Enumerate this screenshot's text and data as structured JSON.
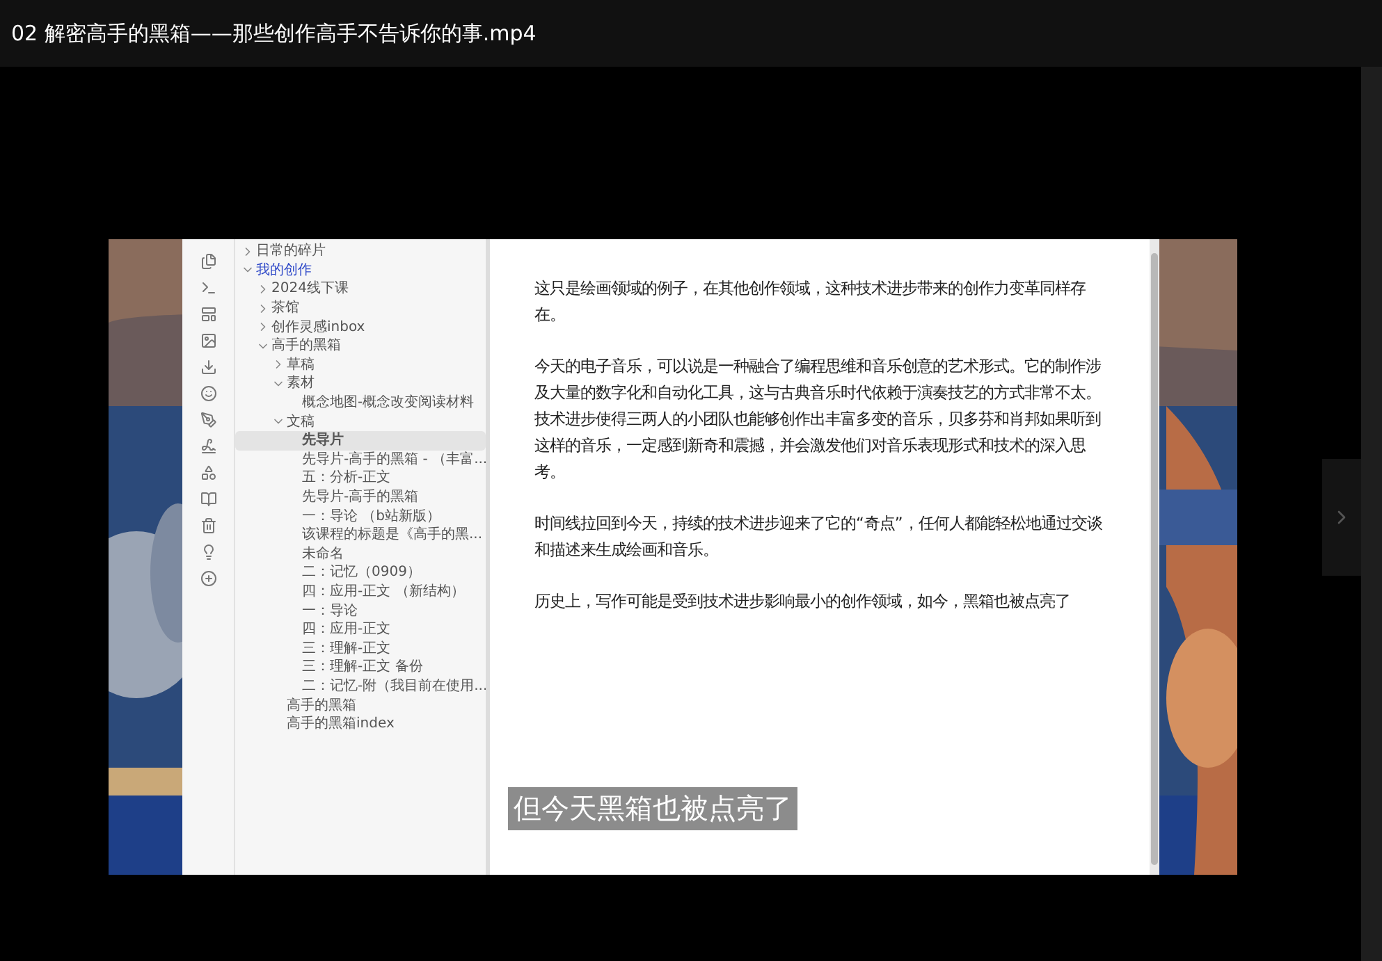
{
  "window": {
    "title": "02 解密高手的黑箱——那些创作高手不告诉你的事.mp4"
  },
  "video": {
    "kind": "picture",
    "tree": [
      {
        "label": "日常的碎片",
        "kind": "folder",
        "expanded": false,
        "current": false,
        "selected": false
      },
      {
        "label": "我的创作",
        "kind": "folder",
        "expanded": true,
        "current": true,
        "selected": false,
        "children": [
          {
            "label": "2024线下课",
            "kind": "folder",
            "expanded": false,
            "current": false,
            "selected": false
          },
          {
            "label": "茶馆",
            "kind": "folder",
            "expanded": false,
            "current": false,
            "selected": false
          },
          {
            "label": "创作灵感inbox",
            "kind": "folder",
            "expanded": false,
            "current": false,
            "selected": false
          },
          {
            "label": "高手的黑箱",
            "kind": "folder",
            "expanded": true,
            "current": false,
            "selected": false,
            "children": [
              {
                "label": "草稿",
                "kind": "folder",
                "expanded": false,
                "current": false,
                "selected": false
              },
              {
                "label": "素材",
                "kind": "folder",
                "expanded": true,
                "current": false,
                "selected": false,
                "children": [
                  {
                    "label": "概念地图-概念改变阅读材料",
                    "kind": "file",
                    "current": false,
                    "selected": false
                  }
                ]
              },
              {
                "label": "文稿",
                "kind": "folder",
                "expanded": true,
                "current": false,
                "selected": false,
                "children": [
                  {
                    "label": "先导片",
                    "kind": "file",
                    "current": false,
                    "selected": true
                  },
                  {
                    "label": "先导片-高手的黑箱 - （丰富...",
                    "kind": "file",
                    "current": false,
                    "selected": false
                  },
                  {
                    "label": "五：分析-正文",
                    "kind": "file",
                    "current": false,
                    "selected": false
                  },
                  {
                    "label": "先导片-高手的黑箱",
                    "kind": "file",
                    "current": false,
                    "selected": false
                  },
                  {
                    "label": "一：导论 （b站新版）",
                    "kind": "file",
                    "current": false,
                    "selected": false
                  },
                  {
                    "label": "该课程的标题是《高手的黑...",
                    "kind": "file",
                    "current": false,
                    "selected": false
                  },
                  {
                    "label": "未命名",
                    "kind": "file",
                    "current": false,
                    "selected": false
                  },
                  {
                    "label": "二：记忆（0909）",
                    "kind": "file",
                    "current": false,
                    "selected": false
                  },
                  {
                    "label": "四：应用-正文 （新结构）",
                    "kind": "file",
                    "current": false,
                    "selected": false
                  },
                  {
                    "label": "一：导论",
                    "kind": "file",
                    "current": false,
                    "selected": false
                  },
                  {
                    "label": "四：应用-正文",
                    "kind": "file",
                    "current": false,
                    "selected": false
                  },
                  {
                    "label": "三：理解-正文",
                    "kind": "file",
                    "current": false,
                    "selected": false
                  },
                  {
                    "label": "三：理解-正文 备份",
                    "kind": "file",
                    "current": false,
                    "selected": false
                  },
                  {
                    "label": "二：记忆-附（我目前在使用...",
                    "kind": "file",
                    "current": false,
                    "selected": false
                  }
                ]
              },
              {
                "label": "高手的黑箱",
                "kind": "file",
                "current": false,
                "selected": false
              },
              {
                "label": "高手的黑箱index",
                "kind": "file",
                "current": false,
                "selected": false
              }
            ]
          }
        ]
      }
    ],
    "paragraphs": [
      "这只是绘画领域的例子，在其他创作领域，这种技术进步带来的创作力变革同样存在。",
      "今天的电子音乐，可以说是一种融合了编程思维和音乐创意的艺术形式。它的制作涉及大量的数字化和自动化工具，这与古典音乐时代依赖于演奏技艺的方式非常不太。技术进步使得三两人的小团队也能够创作出丰富多变的音乐，贝多芬和肖邦如果听到这样的音乐，一定感到新奇和震撼，并会激发他们对音乐表现形式和技术的深入思考。",
      "时间线拉回到今天，持续的技术进步迎来了它的“奇点”，任何人都能轻松地通过交谈和描述来生成绘画和音乐。",
      "历史上，写作可能是受到技术进步影响最小的创作领域，如今，黑箱也被点亮了"
    ],
    "subtitle": "但今天黑箱也被点亮了"
  }
}
